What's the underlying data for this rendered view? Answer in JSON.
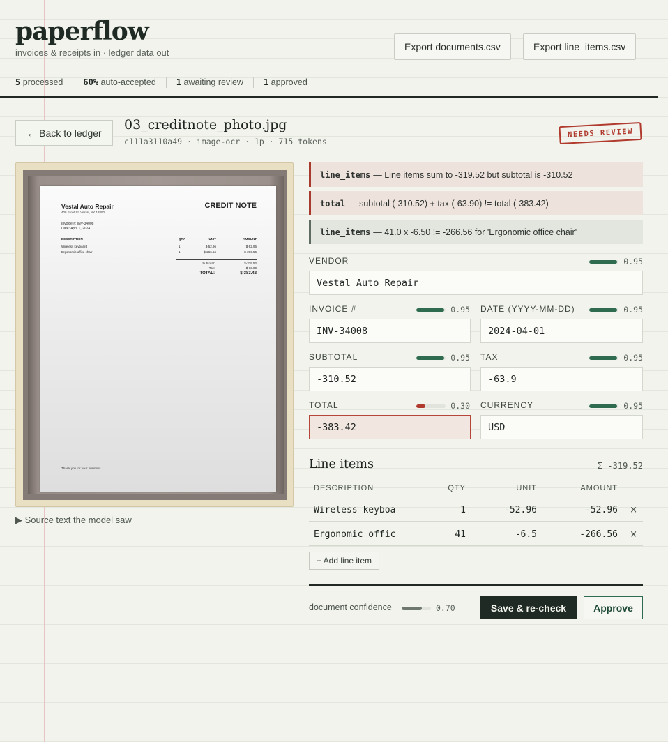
{
  "app": {
    "brand": "paperflow",
    "tagline": "invoices & receipts in  ·  ledger data out"
  },
  "exports": {
    "documents_label": "Export documents.csv",
    "line_items_label": "Export line_items.csv"
  },
  "stats": [
    {
      "value": "5",
      "label": " processed"
    },
    {
      "value": "60%",
      "label": " auto-accepted"
    },
    {
      "value": "1",
      "label": " awaiting review"
    },
    {
      "value": "1",
      "label": " approved"
    }
  ],
  "doc": {
    "back_label": "← Back to ledger",
    "filename": "03_creditnote_photo.jpg",
    "meta": "c111a3110a49 · image-ocr · 1p · 715 tokens",
    "stamp": "NEEDS REVIEW"
  },
  "preview": {
    "vendor": "Vestal Auto Repair",
    "address": "408 Front St, Vestal, NY 13850",
    "title": "CREDIT NOTE",
    "invoice_no": "Invoice #: INV-34008",
    "date": "Date: April 1, 2024",
    "head": {
      "desc": "DESCRIPTION",
      "qty": "QTY",
      "unit": "UNIT",
      "amount": "AMOUNT"
    },
    "rows": [
      {
        "desc": "Wireless keyboard",
        "qty": "1",
        "unit": "$-52.96",
        "amount": "$-52.96"
      },
      {
        "desc": "Ergonomic office chair",
        "qty": "1",
        "unit": "$-266.56",
        "amount": "$-266.56"
      }
    ],
    "subtotal_label": "Subtotal:",
    "subtotal": "$-319.52",
    "tax_label": "Tax:",
    "tax": "$-63.90",
    "total_label": "TOTAL:",
    "total": "$-383.42",
    "thanks": "Thank you for your business."
  },
  "source_toggle": "▶  Source text the model saw",
  "warnings": [
    {
      "field": "line_items",
      "text": "— Line items sum to -319.52 but subtotal is -310.52",
      "severity": "error"
    },
    {
      "field": "total",
      "text": "— subtotal (-310.52) + tax (-63.90) != total (-383.42)",
      "severity": "error"
    },
    {
      "field": "line_items",
      "text": "— 41.0 x -6.50 != -266.56 for 'Ergonomic office chair'",
      "severity": "warning"
    }
  ],
  "fields": {
    "vendor": {
      "label": "VENDOR",
      "value": "Vestal Auto Repair",
      "confidence": "0.95",
      "conf_level": 0.95
    },
    "invoice": {
      "label": "INVOICE #",
      "value": "INV-34008",
      "confidence": "0.95",
      "conf_level": 0.95
    },
    "date": {
      "label": "DATE (YYYY-MM-DD)",
      "value": "2024-04-01",
      "confidence": "0.95",
      "conf_level": 0.95
    },
    "subtotal": {
      "label": "SUBTOTAL",
      "value": "-310.52",
      "confidence": "0.95",
      "conf_level": 0.95
    },
    "tax": {
      "label": "TAX",
      "value": "-63.9",
      "confidence": "0.95",
      "conf_level": 0.95
    },
    "total": {
      "label": "TOTAL",
      "value": "-383.42",
      "confidence": "0.30",
      "conf_level": 0.3
    },
    "currency": {
      "label": "CURRENCY",
      "value": "USD",
      "confidence": "0.95",
      "conf_level": 0.95
    }
  },
  "line_items": {
    "title": "Line items",
    "sum": "Σ -319.52",
    "columns": {
      "desc": "DESCRIPTION",
      "qty": "QTY",
      "unit": "UNIT",
      "amount": "AMOUNT"
    },
    "rows": [
      {
        "desc": "Wireless keyboa",
        "qty": "1",
        "unit": "-52.96",
        "amount": "-52.96",
        "remove": "×"
      },
      {
        "desc": "Ergonomic offic",
        "qty": "41",
        "unit": "-6.5",
        "amount": "-266.56",
        "remove": "×"
      }
    ],
    "add_label": "+ Add line item"
  },
  "footer": {
    "doc_conf_label": "document confidence",
    "doc_conf": "0.70",
    "doc_conf_level": 0.7,
    "save_label": "Save & re-check",
    "approve_label": "Approve"
  },
  "colors": {
    "conf_good": "#2f6b4f",
    "conf_bad": "#b13a2e",
    "conf_neutral": "#6e786f",
    "error_border": "#a8392d",
    "accent_dark": "#1f2a25"
  }
}
